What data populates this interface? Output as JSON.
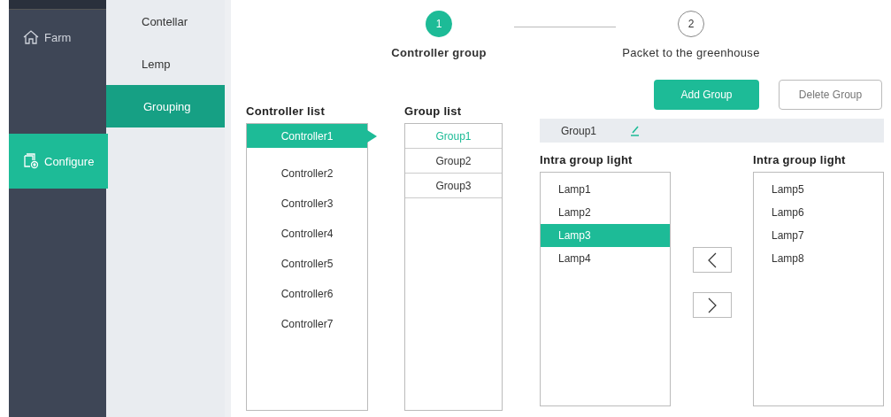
{
  "nav": [
    {
      "label": "Farm",
      "kind": "home",
      "selected": false
    },
    {
      "label": "Configure",
      "kind": "config",
      "selected": true
    }
  ],
  "subnav": [
    {
      "label": "Contellar",
      "selected": false
    },
    {
      "label": "Lemp",
      "selected": false
    },
    {
      "label": "Grouping",
      "selected": true
    }
  ],
  "steps": [
    {
      "number": "1",
      "label": "Controller group",
      "selected": true
    },
    {
      "number": "2",
      "label": "Packet to the greenhouse",
      "selected": false
    }
  ],
  "controller_list": {
    "title": "Controller list",
    "items": [
      {
        "label": "Controller1",
        "selected": true
      },
      {
        "label": "Controller2",
        "selected": false
      },
      {
        "label": "Controller3",
        "selected": false
      },
      {
        "label": "Controller4",
        "selected": false
      },
      {
        "label": "Controller5",
        "selected": false
      },
      {
        "label": "Controller6",
        "selected": false
      },
      {
        "label": "Controller7",
        "selected": false
      }
    ]
  },
  "group_list": {
    "title": "Group list",
    "items": [
      {
        "label": "Group1",
        "selected": true
      },
      {
        "label": "Group2",
        "selected": false
      },
      {
        "label": "Group3",
        "selected": false
      }
    ]
  },
  "buttons": [
    {
      "label": "Add Group",
      "kind": "primary"
    },
    {
      "label": "Delete Group",
      "kind": "secondary"
    }
  ],
  "group_name": "Group1",
  "left_lights": {
    "title": "Intra group light",
    "items": [
      {
        "label": "Lamp1",
        "selected": false
      },
      {
        "label": "Lamp2",
        "selected": false
      },
      {
        "label": "Lamp3",
        "selected": true
      },
      {
        "label": "Lamp4",
        "selected": false
      }
    ]
  },
  "right_lights": {
    "title": "Intra group light",
    "items": [
      {
        "label": "Lamp5",
        "selected": false
      },
      {
        "label": "Lamp6",
        "selected": false
      },
      {
        "label": "Lamp7",
        "selected": false
      },
      {
        "label": "Lamp8",
        "selected": false
      }
    ]
  }
}
